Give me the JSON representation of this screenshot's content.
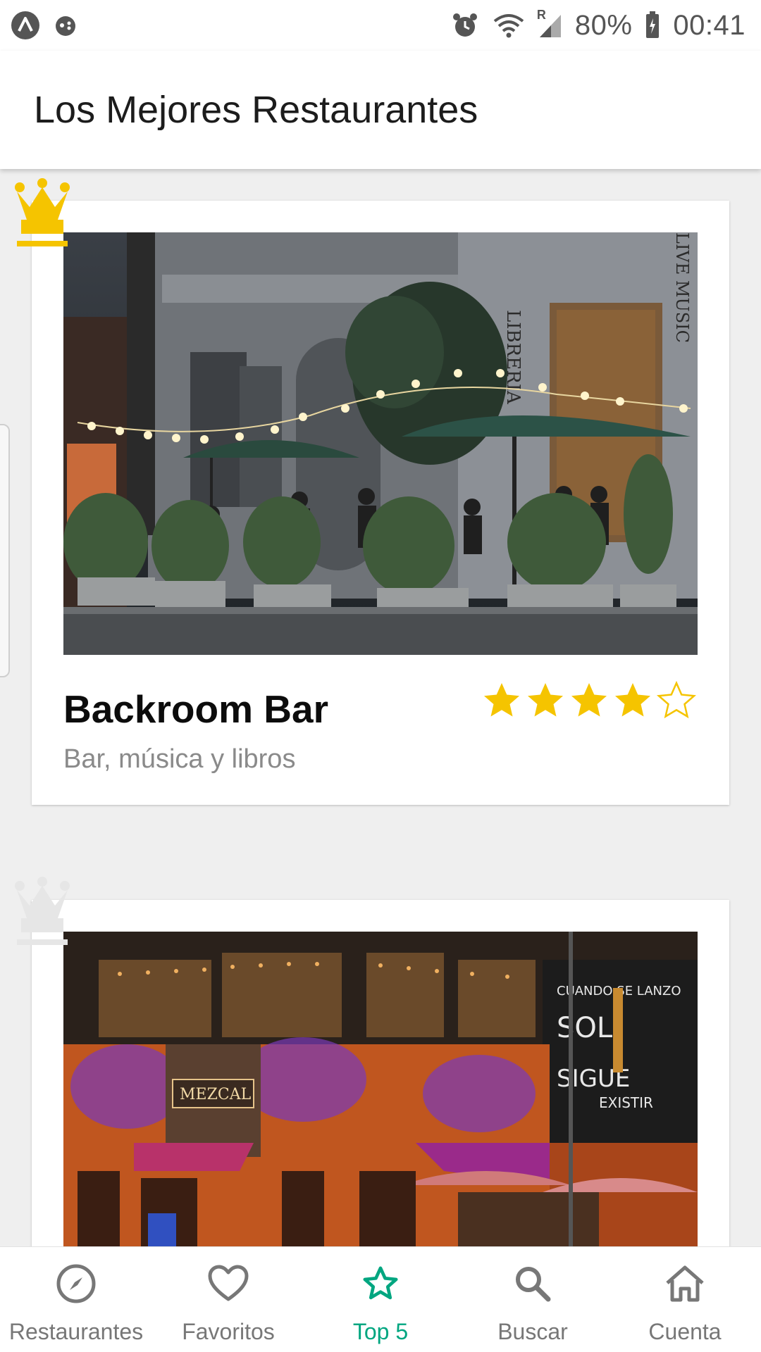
{
  "status_bar": {
    "battery": "80%",
    "time": "00:41",
    "roaming_mark": "R"
  },
  "app_bar": {
    "title": "Los Mejores Restaurantes"
  },
  "restaurants": [
    {
      "rank_icon": "crown-gold-icon",
      "name": "Backroom Bar",
      "description": "Bar, música y libros",
      "rating": 4,
      "rating_max": 5,
      "photo_signs": [
        "LIBRERIA",
        "LIVE MUSIC"
      ]
    },
    {
      "rank_icon": "crown-silver-icon",
      "photo_signs": [
        "MEZCAL",
        "CUANDO SE LANZO",
        "SOL",
        "SIGUE",
        "EXISTIR"
      ]
    }
  ],
  "bottom_nav": [
    {
      "label": "Restaurantes",
      "icon": "compass-icon",
      "active": false
    },
    {
      "label": "Favoritos",
      "icon": "heart-icon",
      "active": false
    },
    {
      "label": "Top 5",
      "icon": "star-icon",
      "active": true
    },
    {
      "label": "Buscar",
      "icon": "search-icon",
      "active": false
    },
    {
      "label": "Cuenta",
      "icon": "home-icon",
      "active": false
    }
  ],
  "colors": {
    "accent": "#00a680",
    "star_gold": "#f5c400",
    "crown_gold": "#f5c400",
    "crown_silver": "#e6e6e6"
  }
}
